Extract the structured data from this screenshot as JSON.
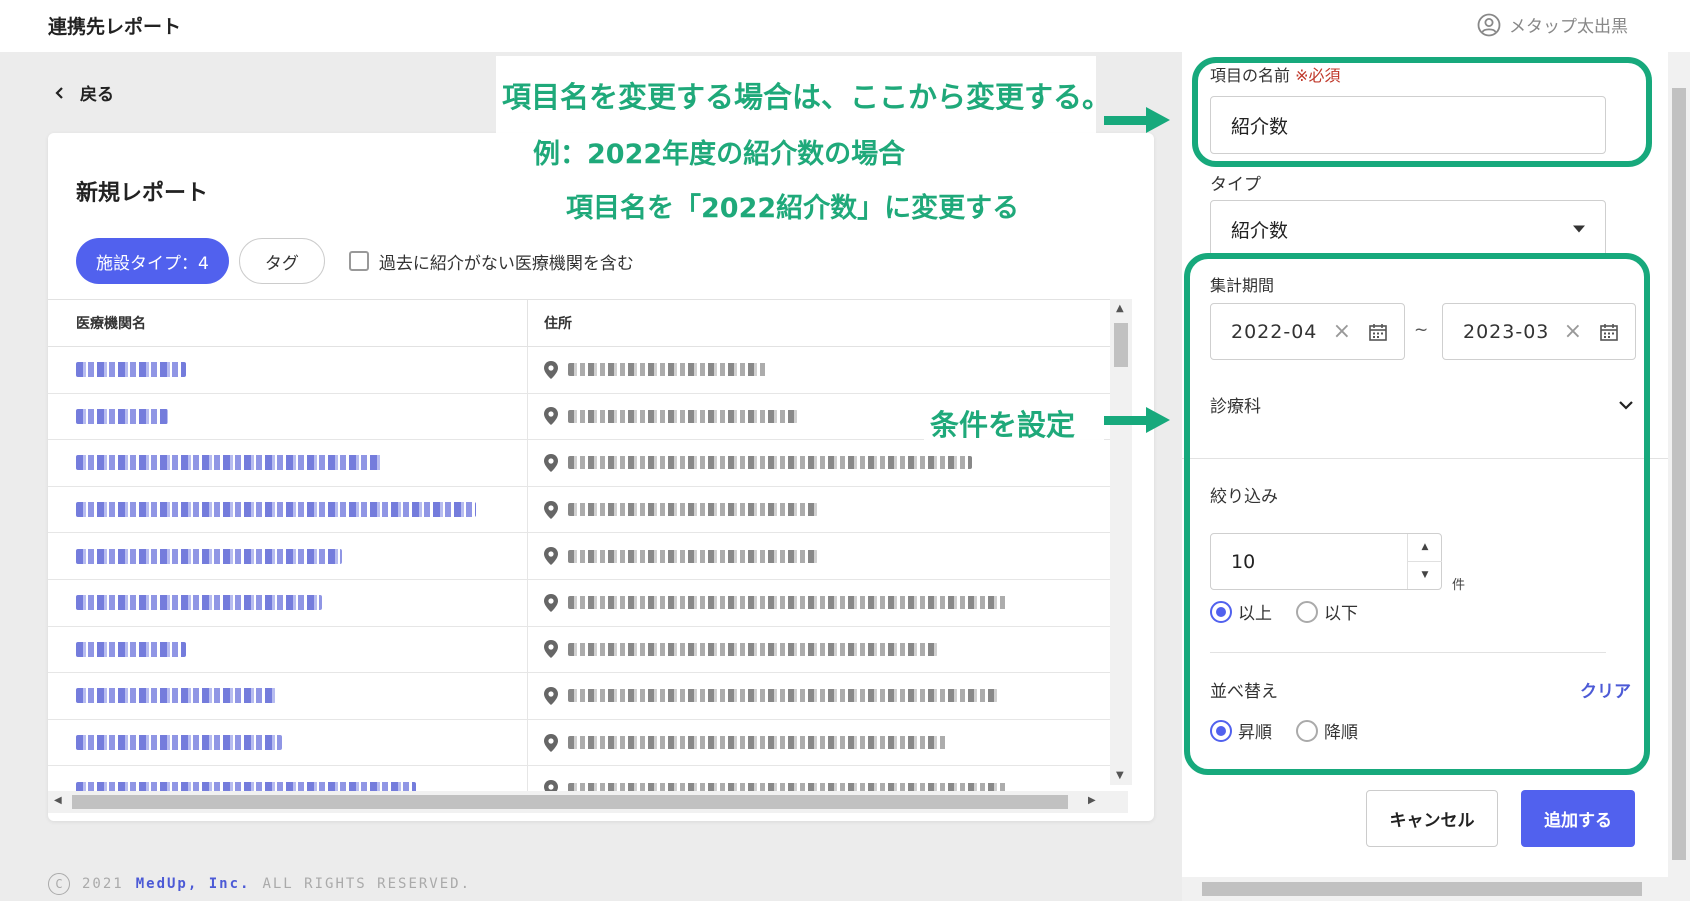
{
  "header": {
    "app_title": "連携先レポート",
    "user_name": "メタップ太出黒"
  },
  "nav": {
    "back_label": "戻る"
  },
  "report": {
    "title": "新規レポート",
    "filter_facility_type": "施設タイプ：4",
    "filter_tag": "タグ",
    "include_no_referral_label": "過去に紹介がない医療機関を含む",
    "columns": [
      "医療機関名",
      "住所"
    ],
    "rows": [
      {
        "name_w": 110,
        "addr_w": 200
      },
      {
        "name_w": 92,
        "addr_w": 230
      },
      {
        "name_w": 306,
        "addr_w": 404
      },
      {
        "name_w": 400,
        "addr_w": 250
      },
      {
        "name_w": 266,
        "addr_w": 250
      },
      {
        "name_w": 246,
        "addr_w": 440
      },
      {
        "name_w": 110,
        "addr_w": 370
      },
      {
        "name_w": 200,
        "addr_w": 430
      },
      {
        "name_w": 206,
        "addr_w": 380
      },
      {
        "name_w": 340,
        "addr_w": 440
      }
    ]
  },
  "footer": {
    "copyright": "2021",
    "brand": "MedUp, Inc.",
    "rights": "ALL RIGHTS RESERVED."
  },
  "panel": {
    "item_name_label": "項目の名前",
    "required_mark": "※必須",
    "item_name_value": "紹介数",
    "type_label": "タイプ",
    "type_value": "紹介数",
    "period_label": "集計期間",
    "period_from": "2022-04",
    "period_to": "2023-03",
    "period_sep": "~",
    "department_label": "診療科",
    "narrow_label": "絞り込み",
    "narrow_value": "10",
    "narrow_unit": "件",
    "narrow_options": [
      "以上",
      "以下"
    ],
    "sort_label": "並べ替え",
    "clear_label": "クリア",
    "sort_options": [
      "昇順",
      "降順"
    ],
    "cancel_label": "キャンセル",
    "add_label": "追加する"
  },
  "annotations": {
    "line1": "項目名を変更する場合は、ここから変更する。",
    "line2": "例：2022年度の紹介数の場合",
    "line3": "項目名を「2022紹介数」に変更する",
    "condition": "条件を設定"
  },
  "colors": {
    "accent": "#5161ee",
    "annotation_green": "#17a97c",
    "required_red": "#c0392b"
  }
}
